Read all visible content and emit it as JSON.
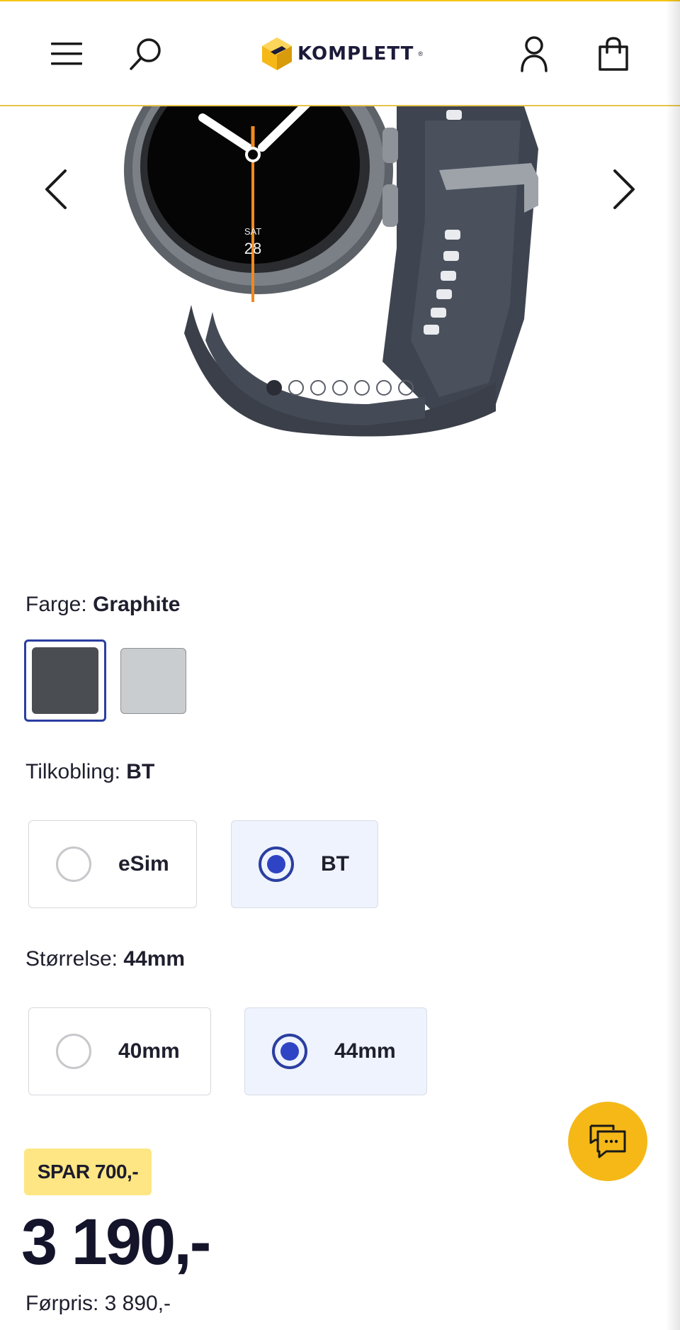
{
  "header": {
    "logo_text": "KOMPLETT",
    "logo_mark": "®",
    "icons": [
      "menu-icon",
      "search-icon",
      "account-icon",
      "cart-icon"
    ]
  },
  "gallery": {
    "watch_face": {
      "day": "SAT",
      "date": "28"
    },
    "image_count": 7,
    "active_index": 0
  },
  "color_option": {
    "label": "Farge:",
    "value": "Graphite",
    "swatches": [
      {
        "name": "Graphite",
        "color": "#4a4d51",
        "selected": true
      },
      {
        "name": "Silver",
        "color": "#c9cdcf",
        "selected": false
      }
    ]
  },
  "connectivity_option": {
    "label": "Tilkobling:",
    "value": "BT",
    "choices": [
      {
        "label": "eSim",
        "selected": false
      },
      {
        "label": "BT",
        "selected": true
      }
    ]
  },
  "size_option": {
    "label": "Størrelse:",
    "value": "44mm",
    "choices": [
      {
        "label": "40mm",
        "selected": false
      },
      {
        "label": "44mm",
        "selected": true
      }
    ]
  },
  "pricing": {
    "save_badge": "SPAR 700,-",
    "price": "3 190,-",
    "old_price": "Førpris: 3 890,-"
  },
  "colors": {
    "accent_yellow": "#f5b816",
    "selection_blue": "#2b3ea0",
    "text_dark": "#14142b"
  }
}
